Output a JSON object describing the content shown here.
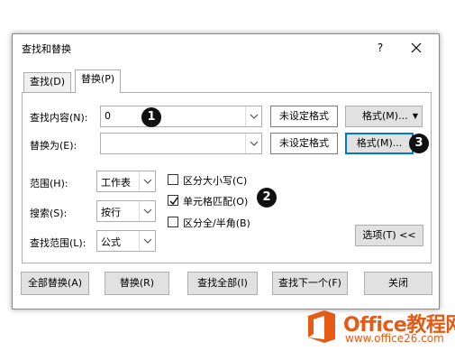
{
  "dialog": {
    "title": "查找和替换",
    "help": "?",
    "tabs": [
      {
        "label": "查找(D)",
        "active": false
      },
      {
        "label": "替换(P)",
        "active": true
      }
    ]
  },
  "find": {
    "label": "查找内容(N):",
    "value": "0",
    "format_preview": "未设定格式",
    "format_button": "格式(M)...",
    "format_arrow": "▼"
  },
  "replace": {
    "label": "替换为(E):",
    "value": "",
    "format_preview": "未设定格式",
    "format_button": "格式(M)..."
  },
  "options": {
    "within_label": "范围(H):",
    "within_value": "工作表",
    "search_label": "搜索(S):",
    "search_value": "按行",
    "lookin_label": "查找范围(L):",
    "lookin_value": "公式",
    "match_case": {
      "label": "区分大小写(C)",
      "checked": false
    },
    "match_entire": {
      "label": "单元格匹配(O)",
      "checked": true
    },
    "match_byte": {
      "label": "区分全/半角(B)",
      "checked": false
    },
    "options_button": "选项(T) <<"
  },
  "footer": {
    "replace_all": "全部替换(A)",
    "replace": "替换(R)",
    "find_all": "查找全部(I)",
    "find_next": "查找下一个(F)",
    "close": "关闭"
  },
  "badges": [
    "1",
    "2",
    "3"
  ],
  "watermark": {
    "brand": "Office教程网",
    "url": "www.office26.com"
  },
  "colors": {
    "focus": "#0078d7",
    "brand": "#e55b16"
  }
}
